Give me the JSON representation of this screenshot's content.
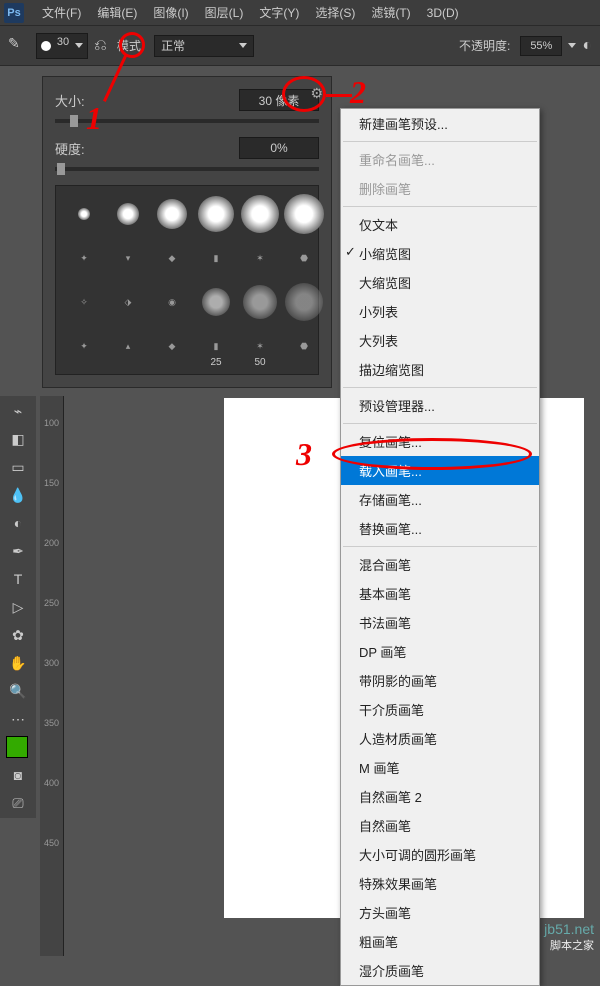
{
  "app": {
    "logo": "Ps"
  },
  "menubar": [
    "文件(F)",
    "编辑(E)",
    "图像(I)",
    "图层(L)",
    "文字(Y)",
    "选择(S)",
    "滤镜(T)",
    "3D(D)"
  ],
  "options": {
    "brush_size": "30",
    "mode_label": "模式:",
    "mode_value": "正常",
    "opacity_label": "不透明度:",
    "opacity_value": "55%"
  },
  "brush_panel": {
    "size_label": "大小:",
    "size_value": "30 像素",
    "hardness_label": "硬度:",
    "hardness_value": "0%",
    "preset_labels": [
      "25",
      "50"
    ]
  },
  "context_menu": {
    "items": [
      {
        "label": "新建画笔预设...",
        "type": "item"
      },
      {
        "type": "sep"
      },
      {
        "label": "重命名画笔...",
        "type": "disabled"
      },
      {
        "label": "删除画笔",
        "type": "disabled"
      },
      {
        "type": "sep"
      },
      {
        "label": "仅文本",
        "type": "item"
      },
      {
        "label": "小缩览图",
        "type": "checked"
      },
      {
        "label": "大缩览图",
        "type": "item"
      },
      {
        "label": "小列表",
        "type": "item"
      },
      {
        "label": "大列表",
        "type": "item"
      },
      {
        "label": "描边缩览图",
        "type": "item"
      },
      {
        "type": "sep"
      },
      {
        "label": "预设管理器...",
        "type": "item"
      },
      {
        "type": "sep"
      },
      {
        "label": "复位画笔...",
        "type": "item"
      },
      {
        "label": "载入画笔...",
        "type": "highlighted"
      },
      {
        "label": "存储画笔...",
        "type": "item"
      },
      {
        "label": "替换画笔...",
        "type": "item"
      },
      {
        "type": "sep"
      },
      {
        "label": "混合画笔",
        "type": "item"
      },
      {
        "label": "基本画笔",
        "type": "item"
      },
      {
        "label": "书法画笔",
        "type": "item"
      },
      {
        "label": "DP 画笔",
        "type": "item"
      },
      {
        "label": "带阴影的画笔",
        "type": "item"
      },
      {
        "label": "干介质画笔",
        "type": "item"
      },
      {
        "label": "人造材质画笔",
        "type": "item"
      },
      {
        "label": "M 画笔",
        "type": "item"
      },
      {
        "label": "自然画笔 2",
        "type": "item"
      },
      {
        "label": "自然画笔",
        "type": "item"
      },
      {
        "label": "大小可调的圆形画笔",
        "type": "item"
      },
      {
        "label": "特殊效果画笔",
        "type": "item"
      },
      {
        "label": "方头画笔",
        "type": "item"
      },
      {
        "label": "粗画笔",
        "type": "item"
      },
      {
        "label": "湿介质画笔",
        "type": "item"
      }
    ]
  },
  "ruler_v": [
    "100",
    "150",
    "200",
    "250",
    "300",
    "350",
    "400",
    "450"
  ],
  "annotations": {
    "1": "1",
    "2": "2",
    "3": "3"
  },
  "watermark": {
    "url": "jb51.net",
    "text": "脚本之家"
  }
}
